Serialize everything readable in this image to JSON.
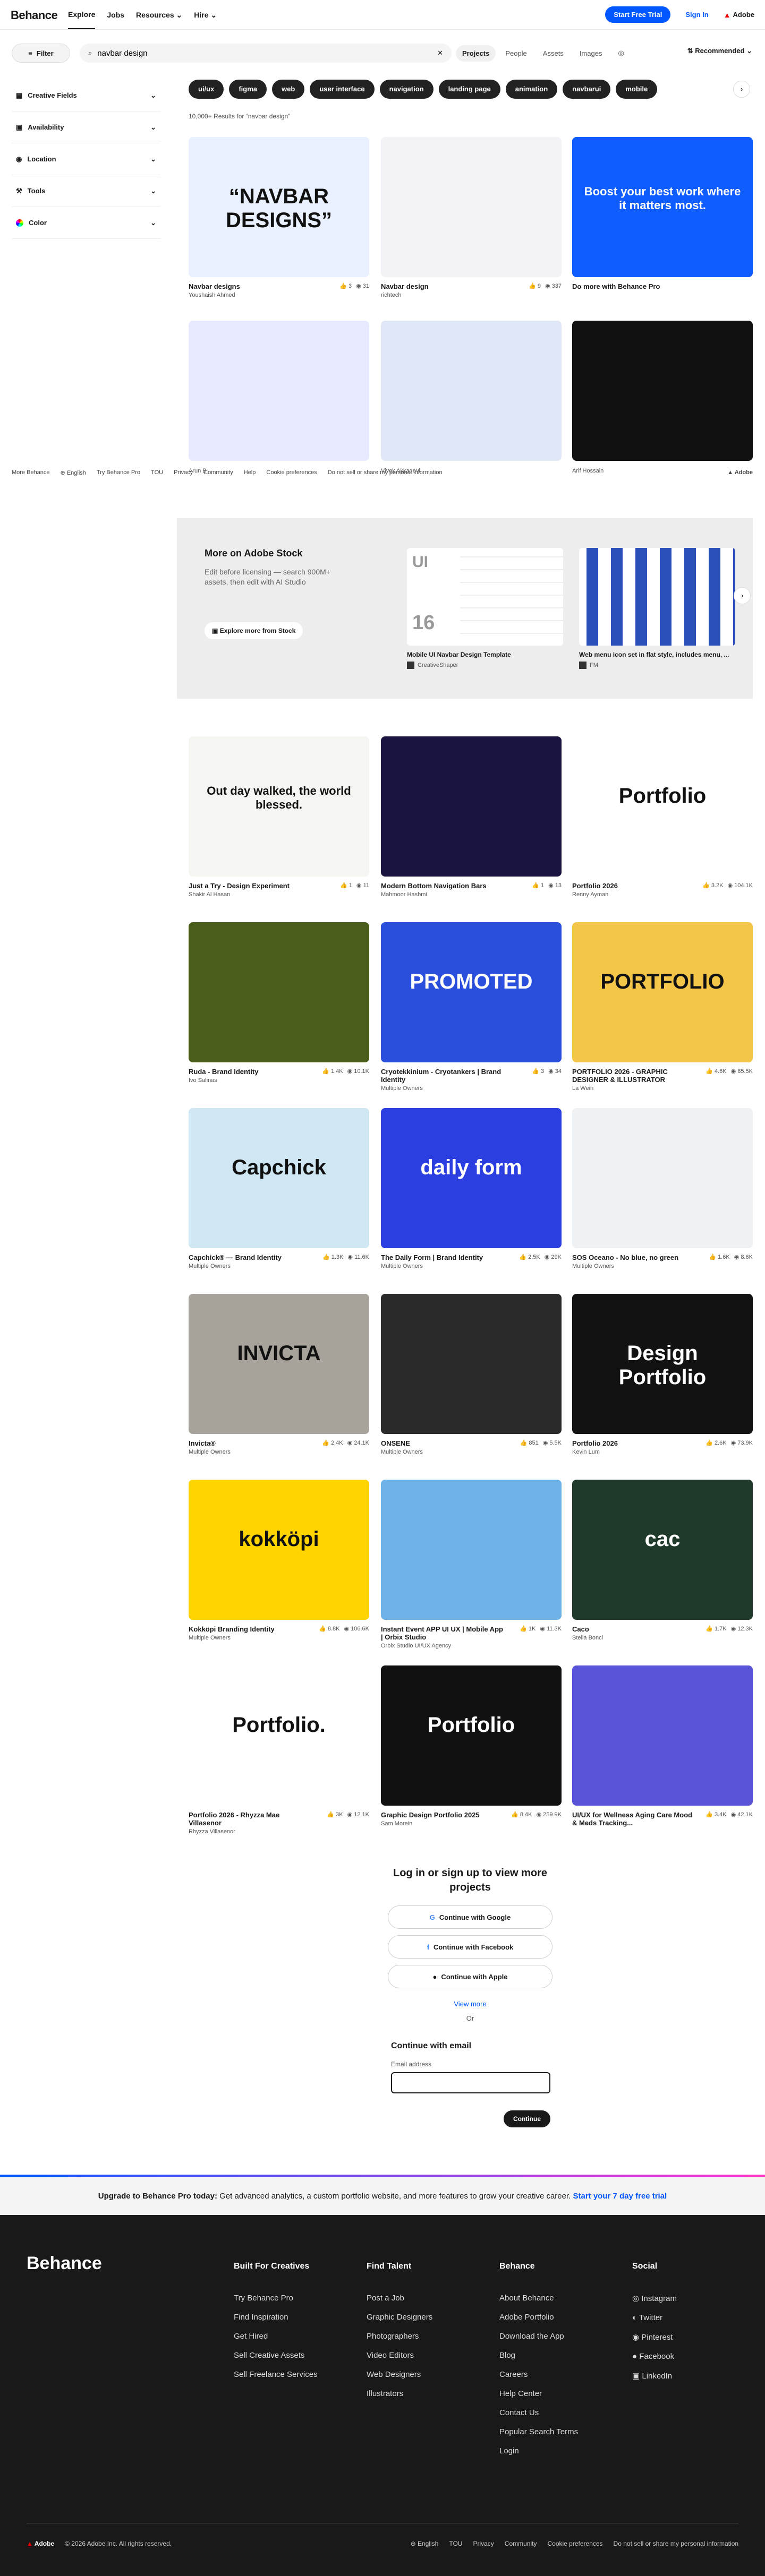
{
  "nav": {
    "logo": "Behance",
    "links": [
      "Explore",
      "Jobs",
      "Resources",
      "Hire"
    ],
    "trial": "Start Free Trial",
    "signin": "Sign In",
    "adobe": "Adobe"
  },
  "search": {
    "filter": "Filter",
    "query": "navbar design",
    "scopes": [
      "Projects",
      "People",
      "Assets",
      "Images"
    ],
    "sort": "Recommended"
  },
  "sidebar": [
    "Creative Fields",
    "Availability",
    "Location",
    "Tools",
    "Color"
  ],
  "tags": [
    "ui/ux",
    "figma",
    "web",
    "user interface",
    "navigation",
    "landing page",
    "animation",
    "navbarui",
    "mobile"
  ],
  "results": "10,000+ Results for “navbar design”",
  "cards": [
    {
      "title": "Navbar designs",
      "owner": "Youshaish Ahmed",
      "likes": "3",
      "views": "31",
      "bg": "#e9f0ff",
      "text": "“NAVBAR DESIGNS”"
    },
    {
      "title": "Navbar design",
      "owner": "richtech",
      "likes": "9",
      "views": "337",
      "bg": "#f2f2f7",
      "text": ""
    },
    {
      "title": "Do more with Behance Pro",
      "owner": "",
      "likes": "",
      "views": "",
      "bg": "#0f5cff",
      "text": "Boost your best work where it matters most."
    },
    {
      "title": "",
      "owner": "Arun B",
      "likes": "",
      "views": "",
      "bg": "#e6e9ff",
      "text": ""
    },
    {
      "title": "",
      "owner": "Vivek Akkadevi",
      "likes": "",
      "views": "",
      "bg": "#dfe6f5",
      "text": ""
    },
    {
      "title": "",
      "owner": "Arif Hossain",
      "likes": "",
      "views": "",
      "bg": "#111",
      "text": ""
    },
    {
      "title": "Just a Try - Design Experiment",
      "owner": "Shakir Al Hasan",
      "likes": "1",
      "views": "11",
      "bg": "#f5f5f2",
      "text": "Out day walked, the world blessed."
    },
    {
      "title": "Modern Bottom Navigation Bars",
      "owner": "Mahmoor Hashmi",
      "likes": "1",
      "views": "13",
      "bg": "#1a1540",
      "text": ""
    },
    {
      "title": "Portfolio 2026",
      "owner": "Renny Ayman",
      "likes": "3.2K",
      "views": "104.1K",
      "bg": "#fff",
      "text": "Portfolio"
    },
    {
      "title": "Ruda - Brand Identity",
      "owner": "Ivo Salinas",
      "likes": "1.4K",
      "views": "10.1K",
      "bg": "#4b5d1a",
      "text": ""
    },
    {
      "title": "Cryotekkinium - Cryotankers | Brand Identity",
      "owner": "Multiple Owners",
      "likes": "3",
      "views": "34",
      "bg": "#2a4fdc",
      "text": "PROMOTED"
    },
    {
      "title": "PORTFOLIO 2026 - GRAPHIC DESIGNER & ILLUSTRATOR",
      "owner": "La Weiri",
      "likes": "4.6K",
      "views": "85.5K",
      "bg": "#f3c64a",
      "text": "PORTFOLIO"
    },
    {
      "title": "Capchick® — Brand Identity",
      "owner": "Multiple Owners",
      "likes": "1.3K",
      "views": "11.6K",
      "bg": "#cfe6f3",
      "text": "Capchick"
    },
    {
      "title": "The Daily Form | Brand Identity",
      "owner": "Multiple Owners",
      "likes": "2.5K",
      "views": "29K",
      "bg": "#2b3fe0",
      "text": "daily form"
    },
    {
      "title": "SOS Oceano - No blue, no green",
      "owner": "Multiple Owners",
      "likes": "1.6K",
      "views": "8.6K",
      "bg": "#eef2f5",
      "text": ""
    },
    {
      "title": "Invicta®",
      "owner": "Multiple Owners",
      "likes": "2.4K",
      "views": "24.1K",
      "bg": "#a7a39a",
      "text": "INVICTA"
    },
    {
      "title": "ONSENE",
      "owner": "Multiple Owners",
      "likes": "851",
      "views": "5.5K",
      "bg": "#2a2a2a",
      "text": ""
    },
    {
      "title": "Portfolio 2026",
      "owner": "Kevin Lum",
      "likes": "2.6K",
      "views": "73.9K",
      "bg": "#121212",
      "text": "Design Portfolio"
    },
    {
      "title": "Kokköpi Branding Identity",
      "owner": "Multiple Owners",
      "likes": "8.8K",
      "views": "106.6K",
      "bg": "#ffd400",
      "text": "kokköpi"
    },
    {
      "title": "Instant Event APP UI UX | Mobile App | Orbix Studio",
      "owner": "Orbix Studio UI/UX Agency",
      "likes": "1K",
      "views": "11.3K",
      "bg": "#6db3e8",
      "text": ""
    },
    {
      "title": "Caco",
      "owner": "Stella Bonci",
      "likes": "1.7K",
      "views": "12.3K",
      "bg": "#1f3a2a",
      "text": "cac"
    },
    {
      "title": "Portfolio 2026 - Rhyzza Mae Villasenor",
      "owner": "Rhyzza Villasenor",
      "likes": "3K",
      "views": "12.1K",
      "bg": "#fff",
      "text": "Portfolio."
    },
    {
      "title": "Graphic Design Portfolio 2025",
      "owner": "Sam Morein",
      "likes": "8.4K",
      "views": "259.9K",
      "bg": "#111",
      "text": "Portfolio"
    },
    {
      "title": "UI/UX for Wellness Aging Care Mood & Meds Tracking...",
      "owner": "",
      "likes": "3.4K",
      "views": "42.1K",
      "bg": "#5a55d6",
      "text": ""
    }
  ],
  "footer_mini": [
    "More Behance",
    "English",
    "Try Behance Pro",
    "TOU",
    "Privacy",
    "Community",
    "Help",
    "Cookie preferences",
    "Do not sell or share my personal information"
  ],
  "stock": {
    "title": "More on Adobe Stock",
    "desc": "Edit before licensing — search 900M+ assets, then edit with AI Studio",
    "btn": "Explore more from Stock",
    "c1": "Mobile UI Navbar Design Template",
    "c1by": "CreativeShaper",
    "c2": "Web menu icon set in flat style, includes menu, ...",
    "c2by": "FM"
  },
  "login": {
    "title": "Log in or sign up to view more projects",
    "google": "Continue with Google",
    "facebook": "Continue with Facebook",
    "apple": "Continue with Apple",
    "more": "View more",
    "or": "Or",
    "email_title": "Continue with email",
    "email_label": "Email address",
    "continue": "Continue"
  },
  "upgrade": {
    "lead": "Upgrade to Behance Pro today:",
    "body": "Get advanced analytics, a custom portfolio website, and more features to grow your creative career.",
    "cta": "Start your 7 day free trial"
  },
  "footer": {
    "logo": "Behance",
    "cols": [
      {
        "h": "Built For Creatives",
        "items": [
          "Try Behance Pro",
          "Find Inspiration",
          "Get Hired",
          "Sell Creative Assets",
          "Sell Freelance Services"
        ]
      },
      {
        "h": "Find Talent",
        "items": [
          "Post a Job",
          "Graphic Designers",
          "Photographers",
          "Video Editors",
          "Web Designers",
          "Illustrators"
        ]
      },
      {
        "h": "Behance",
        "items": [
          "About Behance",
          "Adobe Portfolio",
          "Download the App",
          "Blog",
          "Careers",
          "Help Center",
          "Contact Us",
          "Popular Search Terms",
          "Login"
        ]
      },
      {
        "h": "Social",
        "items": [
          "Instagram",
          "Twitter",
          "Pinterest",
          "Facebook",
          "LinkedIn"
        ]
      }
    ],
    "bottom": [
      "Adobe",
      "© 2026 Adobe Inc. All rights reserved.",
      "English",
      "TOU",
      "Privacy",
      "Community",
      "Cookie preferences",
      "Do not sell or share my personal information"
    ]
  }
}
